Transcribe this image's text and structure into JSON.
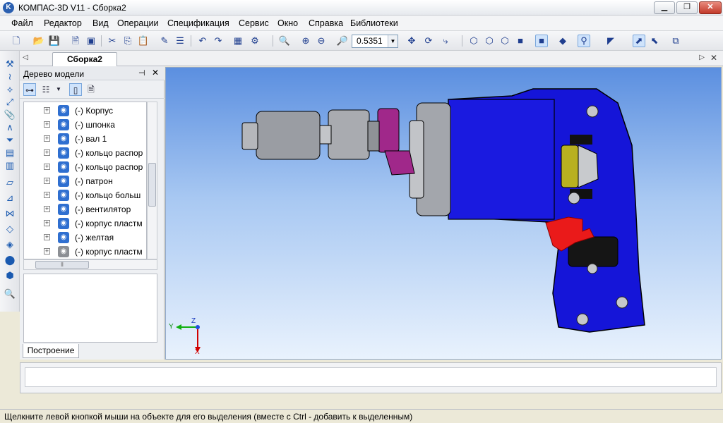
{
  "window": {
    "app_icon_letter": "K",
    "title": "КОМПАС-3D V11 - Сборка2",
    "min_symbol": "▁",
    "max_symbol": "❐",
    "close_symbol": "✕"
  },
  "menu": [
    "Файл",
    "Редактор",
    "Вид",
    "Операции",
    "Спецификация",
    "Сервис",
    "Окно",
    "Справка",
    "Библиотеки"
  ],
  "toolbar": {
    "zoom_value": "0.5351",
    "dropdown_symbol": "▼"
  },
  "document_tabs": {
    "active_tab": "Сборка2",
    "left_arrow": "◁",
    "right_arrow": "▷",
    "close_symbol": "✕"
  },
  "model_tree": {
    "title": "Дерево модели",
    "pin_symbol": "⊣",
    "close_symbol": "✕",
    "items": [
      {
        "label": "(-) Корпус",
        "icon": "part-icon"
      },
      {
        "label": "(-) шпонка",
        "icon": "part-icon"
      },
      {
        "label": "(-) вал 1",
        "icon": "part-icon"
      },
      {
        "label": "(-) кольцо распор",
        "icon": "part-icon"
      },
      {
        "label": "(-) кольцо распор",
        "icon": "part-icon"
      },
      {
        "label": "(-) патрон",
        "icon": "part-icon"
      },
      {
        "label": "(-) кольцо больш",
        "icon": "part-icon"
      },
      {
        "label": "(-) вентилятор",
        "icon": "part-icon"
      },
      {
        "label": "(-) корпус пластм",
        "icon": "part-icon"
      },
      {
        "label": "(-) желтая",
        "icon": "part-icon"
      },
      {
        "label": "(-) корпус пластм",
        "icon": "part-icon-gray"
      }
    ],
    "bottom_tab": "Построение"
  },
  "viewport": {
    "axis_y": "Y",
    "axis_z": "Z",
    "axis_x": "X"
  },
  "status": {
    "message": "Щелкните левой кнопкой мыши на объекте для его выделения (вместе с Ctrl - добавить к выделенным)"
  },
  "colors": {
    "body_blue": "#1515d8",
    "gear_purple": "#a0288a",
    "trigger_red": "#ea1a1a",
    "metal_gray": "#a9abb0",
    "bearing_yellow": "#b8b020"
  }
}
